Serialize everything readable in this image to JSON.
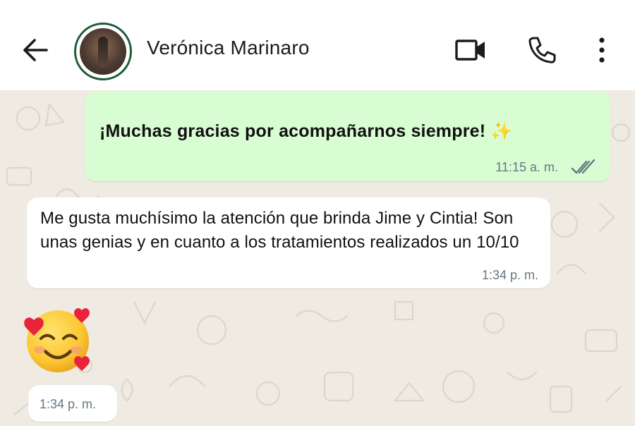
{
  "header": {
    "contact_name": "Verónica Marinaro",
    "icons": {
      "back": "arrow-left-icon",
      "video": "video-camera-icon",
      "call": "phone-icon",
      "menu": "more-vertical-icon"
    }
  },
  "messages": [
    {
      "direction": "outgoing",
      "text": "¡Muchas gracias por acompañarnos siempre!",
      "emoji": "✨",
      "time": "11:15 a. m.",
      "status": "read-double-check"
    },
    {
      "direction": "incoming",
      "text": "Me gusta muchísimo la atención que brinda Jime y Cintia! Son unas genias y en cuanto a los tratamientos realizados un 10/10",
      "time": "1:34 p. m."
    },
    {
      "direction": "incoming",
      "emoji": "🥰",
      "time": "1:34 p. m."
    }
  ],
  "colors": {
    "header_bg": "#ffffff",
    "chat_bg": "#efeae2",
    "outgoing_bubble": "#d9fdd3",
    "incoming_bubble": "#ffffff",
    "timestamp": "#667781",
    "avatar_ring": "#1f5c3a"
  }
}
